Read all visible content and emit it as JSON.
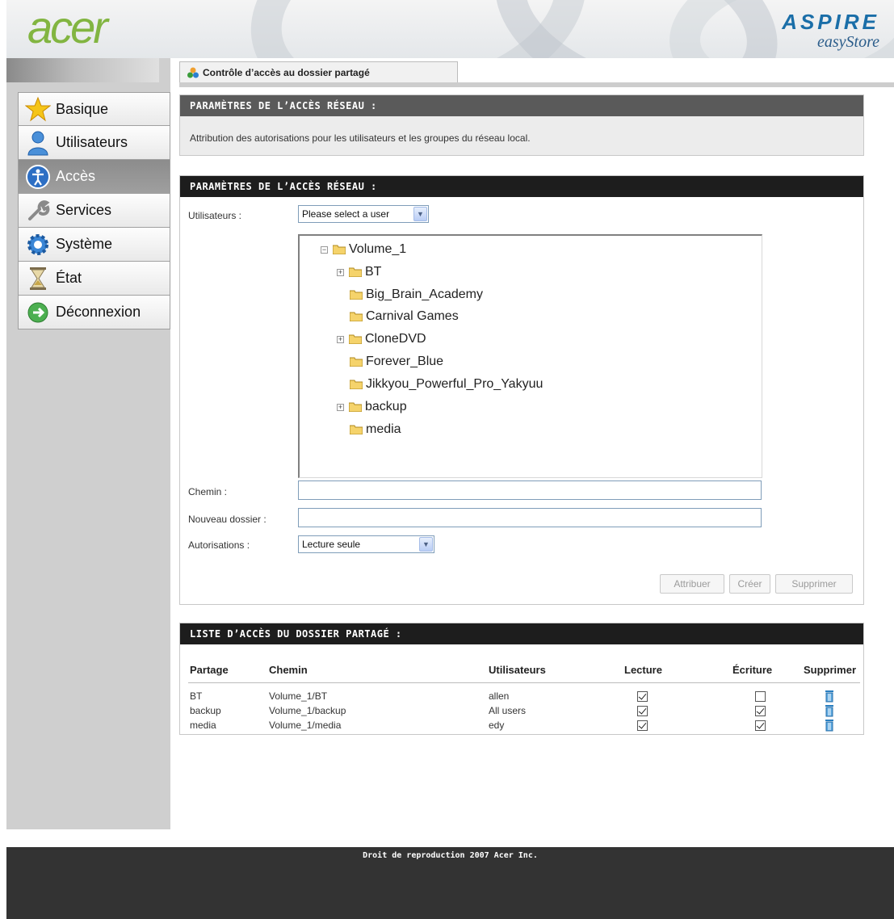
{
  "header": {
    "logo": "acer",
    "brand_line1": "ASPIRE",
    "brand_line2": "easyStore"
  },
  "sidebar": {
    "items": [
      {
        "label": "Basique",
        "icon": "star-icon",
        "active": false
      },
      {
        "label": "Utilisateurs",
        "icon": "user-icon",
        "active": false
      },
      {
        "label": "Accès",
        "icon": "accessibility-icon",
        "active": true
      },
      {
        "label": "Services",
        "icon": "wrench-icon",
        "active": false
      },
      {
        "label": "Système",
        "icon": "gear-icon",
        "active": false
      },
      {
        "label": "État",
        "icon": "hourglass-icon",
        "active": false
      },
      {
        "label": "Déconnexion",
        "icon": "logout-icon",
        "active": false
      }
    ]
  },
  "tab": {
    "label": "Contrôle d’accès au dossier partagé",
    "icon": "share-icon"
  },
  "section1": {
    "title": "PARAMÈTRES DE L’ACCÈS RÉSEAU :",
    "description": "Attribution des autorisations pour les utilisateurs et les groupes du réseau local."
  },
  "section2": {
    "title": "PARAMÈTRES DE L’ACCÈS RÉSEAU :",
    "users_label": "Utilisateurs :",
    "users_select": "Please select a user",
    "tree": {
      "root": "Volume_1",
      "children": [
        {
          "name": "BT",
          "expandable": true
        },
        {
          "name": "Big_Brain_Academy",
          "expandable": false
        },
        {
          "name": "Carnival Games",
          "expandable": false
        },
        {
          "name": "CloneDVD",
          "expandable": true
        },
        {
          "name": "Forever_Blue",
          "expandable": false
        },
        {
          "name": "Jikkyou_Powerful_Pro_Yakyuu",
          "expandable": false
        },
        {
          "name": "backup",
          "expandable": true
        },
        {
          "name": "media",
          "expandable": false
        }
      ]
    },
    "path_label": "Chemin :",
    "path_value": "",
    "new_folder_label": "Nouveau dossier :",
    "new_folder_value": "",
    "permissions_label": "Autorisations :",
    "permissions_select": "Lecture seule",
    "buttons": {
      "assign": "Attribuer",
      "create": "Créer",
      "delete": "Supprimer"
    }
  },
  "section3": {
    "title": "LISTE D’ACCÈS DU DOSSIER PARTAGÉ :",
    "columns": [
      "Partage",
      "Chemin",
      "Utilisateurs",
      "Lecture",
      "Écriture",
      "Supprimer"
    ],
    "rows": [
      {
        "share": "BT",
        "path": "Volume_1/BT",
        "users": "allen",
        "read": true,
        "write": false
      },
      {
        "share": "backup",
        "path": "Volume_1/backup",
        "users": "All users",
        "read": true,
        "write": true
      },
      {
        "share": "media",
        "path": "Volume_1/media",
        "users": "edy",
        "read": true,
        "write": true
      }
    ]
  },
  "footer": {
    "copyright": "Droit de reproduction 2007 Acer Inc."
  },
  "colors": {
    "logo_green": "#82b541",
    "brand_blue": "#1a6ea8",
    "panel_header": "#1d1d1d",
    "footer": "#333333",
    "sidebar_active": "#8c8c8c"
  }
}
